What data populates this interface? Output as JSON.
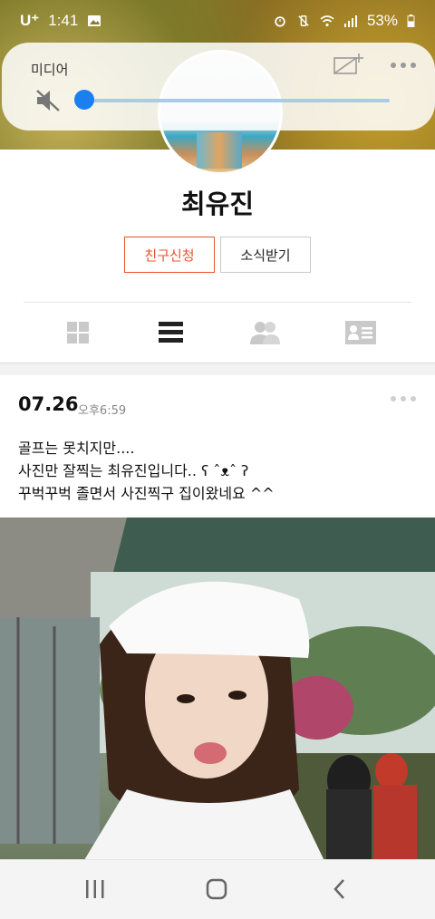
{
  "status_bar": {
    "carrier": "U⁺",
    "time": "1:41",
    "battery": "53%",
    "icons": [
      "gallery-icon",
      "alarm-icon",
      "vibrate-mute-icon",
      "wifi-icon",
      "signal-icon",
      "battery-icon"
    ]
  },
  "media_panel": {
    "title": "미디어",
    "volume_level": 0,
    "icons": [
      "mute-speaker-icon",
      "cast-off-icon",
      "more-icon"
    ],
    "accent": "#1b7ff0"
  },
  "profile": {
    "name": "최유진",
    "friend_button": "친구신청",
    "news_button": "소식받기",
    "accent": "#e9532d",
    "tabs": [
      "grid-view-icon",
      "list-view-icon",
      "friends-icon",
      "profile-card-icon"
    ],
    "selected_tab": "list-view-icon"
  },
  "post": {
    "date": "07.26",
    "time": "오후6:59",
    "lines": [
      "골프는 못치지만....",
      "사진만 잘찍는 최유진입니다.. ʕ ˆᴥˆ ʔ",
      "꾸벅꾸벅 졸면서 사진찍구 집이왔네요 ^^"
    ]
  },
  "nav_bar": {
    "icons": [
      "recent-apps-icon",
      "home-icon",
      "back-icon"
    ]
  }
}
